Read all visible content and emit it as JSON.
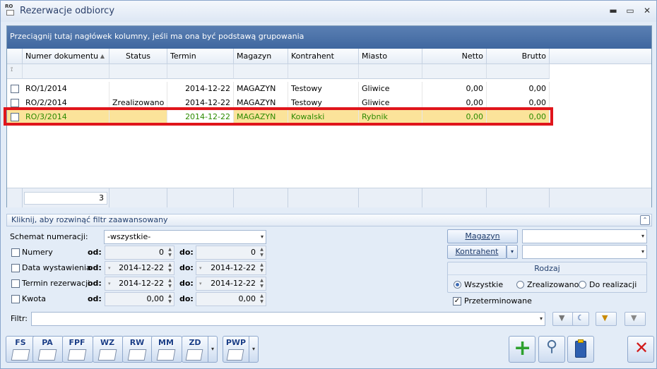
{
  "window": {
    "title": "Rezerwacje odbiorcy",
    "app_icon_text": "RO"
  },
  "grid": {
    "group_hint": "Przeciągnij tutaj nagłówek kolumny, jeśli ma ona być podstawą grupowania",
    "columns": [
      "Numer dokumentu",
      "Status",
      "Termin rezerwacji",
      "Magazyn",
      "Kontrahent",
      "Miasto",
      "Netto",
      "Brutto"
    ],
    "sort_indicator": "▲",
    "rows": [
      {
        "numer": "RO/1/2014",
        "status": "",
        "termin": "2014-12-22",
        "magazyn": "MAGAZYN",
        "kontrahent": "Testowy",
        "miasto": "Gliwice",
        "netto": "0,00",
        "brutto": "0,00"
      },
      {
        "numer": "RO/2/2014",
        "status": "Zrealizowano",
        "termin": "2014-12-22",
        "magazyn": "MAGAZYN",
        "kontrahent": "Testowy",
        "miasto": "Gliwice",
        "netto": "0,00",
        "brutto": "0,00"
      },
      {
        "numer": "RO/3/2014",
        "status": "",
        "termin": "2014-12-22",
        "magazyn": "MAGAZYN",
        "kontrahent": "Kowalski",
        "miasto": "Rybnik",
        "netto": "0,00",
        "brutto": "0,00"
      }
    ],
    "footer_count": "3"
  },
  "filter": {
    "header": "Kliknij, aby rozwinąć filtr zaawansowany",
    "schemat_label": "Schemat numeracji:",
    "schemat_value": "-wszystkie-",
    "numery_label": "Numery",
    "data_label": "Data wystawienia",
    "termin_label": "Termin rezerwacji",
    "kwota_label": "Kwota",
    "od": "od:",
    "do": "do:",
    "numery_od": "0",
    "numery_do": "0",
    "data_od": "2014-12-22",
    "data_do": "2014-12-22",
    "termin_od": "2014-12-22",
    "termin_do": "2014-12-22",
    "kwota_od": "0,00",
    "kwota_do": "0,00",
    "magazyn_btn": "Magazyn",
    "kontrahent_btn": "Kontrahent",
    "rodzaj_title": "Rodzaj",
    "radio_wszystkie": "Wszystkie",
    "radio_zrealizowano": "Zrealizowano",
    "radio_do_realizacji": "Do realizacji",
    "przeterminowane": "Przeterminowane",
    "filtr_label": "Filtr:"
  },
  "toolbar": {
    "buttons": [
      "FS",
      "PA",
      "FPF",
      "WZ",
      "RW",
      "MM",
      "ZD",
      "PWP"
    ]
  }
}
